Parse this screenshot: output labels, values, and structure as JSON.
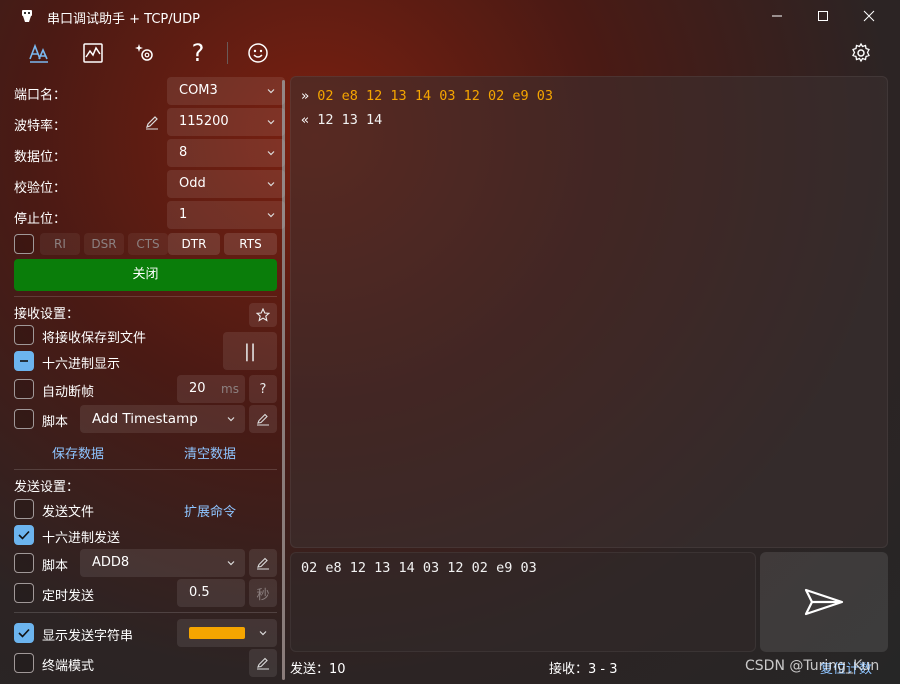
{
  "window": {
    "title": "串口调试助手 + TCP/UDP",
    "minimize_icon": "minimize-icon",
    "maximize_icon": "maximize-icon",
    "close_icon": "close-icon"
  },
  "toolbar": {
    "icons": [
      "font-icon",
      "chart-icon",
      "sparkle-gear-icon",
      "help-icon",
      "smiley-icon"
    ],
    "settings_icon": "gear-icon",
    "help_glyph": "?"
  },
  "serial": {
    "port_label": "端口名：",
    "port_value": "COM3",
    "baud_label": "波特率：",
    "baud_value": "115200",
    "databits_label": "数据位：",
    "databits_value": "8",
    "parity_label": "校验位：",
    "parity_value": "Odd",
    "stopbits_label": "停止位：",
    "stopbits_value": "1",
    "signals": [
      "RI",
      "DSR",
      "CTS",
      "DTR",
      "RTS"
    ],
    "close_label": "关闭"
  },
  "receive": {
    "section_label": "接收设置：",
    "save_to_file": "将接收保存到文件",
    "hex_display": "十六进制显示",
    "auto_frame": "自动断帧",
    "frame_value": "20",
    "frame_unit": "ms",
    "frame_help": "?",
    "script_label": "脚本",
    "script_value": "Add Timestamp",
    "save_data": "保存数据",
    "clear_data": "清空数据",
    "pause_glyph": "||"
  },
  "send": {
    "section_label": "发送设置：",
    "send_file": "发送文件",
    "ext_cmd": "扩展命令",
    "hex_send": "十六进制发送",
    "script_label": "脚本",
    "script_value": "ADD8",
    "timed_send": "定时发送",
    "timed_value": "0.5",
    "timed_unit": "秒",
    "show_send_string": "显示发送字符串",
    "show_color": "#f5a500",
    "terminal_mode": "终端模式"
  },
  "log": {
    "tx_prefix": "»",
    "tx_line": "02 e8 12 13 14 03 12 02 e9 03",
    "rx_prefix": "«",
    "rx_line": "12 13 14",
    "tx_color": "#f5a500",
    "rx_color": "#f2f2f2"
  },
  "send_box": {
    "text": "02 e8 12 13 14 03 12 02 e9 03",
    "send_icon": "send-icon"
  },
  "status": {
    "sent": "发送：10",
    "received": "接收：3 - 3",
    "reset": "复位计数"
  },
  "watermark": "CSDN @Turing_Kun"
}
